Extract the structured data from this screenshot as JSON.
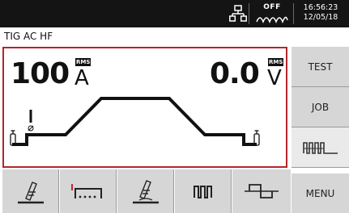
{
  "status_bar": {
    "network_icon": "network-icon",
    "wave_off_label": "OFF",
    "time": "16:56:23",
    "date": "12/05/18"
  },
  "process_title": "TIG AC HF",
  "readouts": {
    "current_value": "100",
    "current_unit": "A",
    "current_rms": "RMS",
    "voltage_value": "0.0",
    "voltage_unit": "V",
    "voltage_rms": "RMS"
  },
  "sidebar": {
    "test_label": "TEST",
    "job_label": "JOB",
    "pulse_mode_icon": "pulse-wave-icon",
    "menu_label": "MENU"
  },
  "bottom_toolbar": [
    {
      "icon": "torch-icon"
    },
    {
      "icon": "trigger-mode-icon"
    },
    {
      "icon": "torch-electrode-icon"
    },
    {
      "icon": "pulse-wave-icon"
    },
    {
      "icon": "ac-square-wave-icon"
    }
  ],
  "colors": {
    "accent_red": "#b3262c",
    "topbar_bg": "#141414",
    "button_gray": "#d6d6d6"
  }
}
